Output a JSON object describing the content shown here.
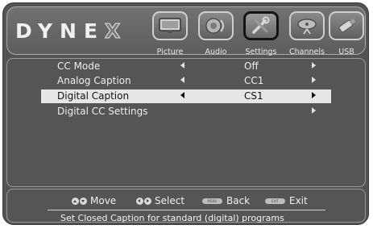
{
  "brand": {
    "logo": "DYNE",
    "logo_x": "X"
  },
  "tabs": [
    {
      "label": "Picture",
      "icon": "tv-picture-icon",
      "active": false
    },
    {
      "label": "Audio",
      "icon": "speaker-audio-icon",
      "active": false
    },
    {
      "label": "Settings",
      "icon": "tools-settings-icon",
      "active": true
    },
    {
      "label": "Channels",
      "icon": "satellite-dish-channels-icon",
      "active": false
    },
    {
      "label": "USB",
      "icon": "usb-drive-icon",
      "active": false
    }
  ],
  "menu": {
    "items": [
      {
        "label": "CC Mode",
        "value": "Off",
        "selected": false
      },
      {
        "label": "Analog Caption",
        "value": "CC1",
        "selected": false
      },
      {
        "label": "Digital Caption",
        "value": "CS1",
        "selected": true
      },
      {
        "label": "Digital CC Settings",
        "value": "",
        "selected": false
      }
    ]
  },
  "footer": {
    "move": "Move",
    "select": "Select",
    "back": "Back",
    "exit": "Exit",
    "menu_key": "MENU",
    "exit_key": "EXIT",
    "status": "Set Closed Caption for standard (digital) programs"
  },
  "colors": {
    "background": "#535353",
    "highlight": "#e6e6e6",
    "text": "#eeeeee"
  }
}
